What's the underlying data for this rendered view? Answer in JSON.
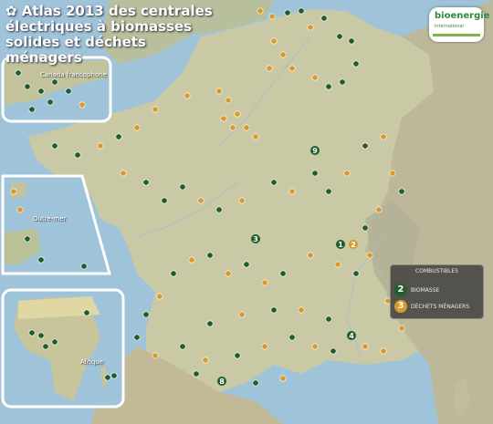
{
  "title_lines": [
    "✿ Atlas 2013 des centrales",
    "électriques à biomasses",
    "solides et déchets ménagers"
  ],
  "logo": {
    "word": "bioenergie",
    "sub": "international"
  },
  "insets": {
    "canada_label": "Canada francophone",
    "outremer_label": "Outre-mer",
    "africa_label": "Afrique"
  },
  "legend": {
    "title": "COMBUSTIBLES",
    "items": [
      {
        "number": "2",
        "label": "BIOMASSE",
        "color": "#1f5e2c"
      },
      {
        "number": "3",
        "label": "DÉCHETS MÉNAGERS",
        "color": "#d99a2b"
      }
    ]
  },
  "marker_colors": {
    "biomasse": "#1f5e2c",
    "dechets": "#d99a2b"
  },
  "map_labels": [
    "1",
    "2",
    "3",
    "4",
    "8",
    "9"
  ]
}
